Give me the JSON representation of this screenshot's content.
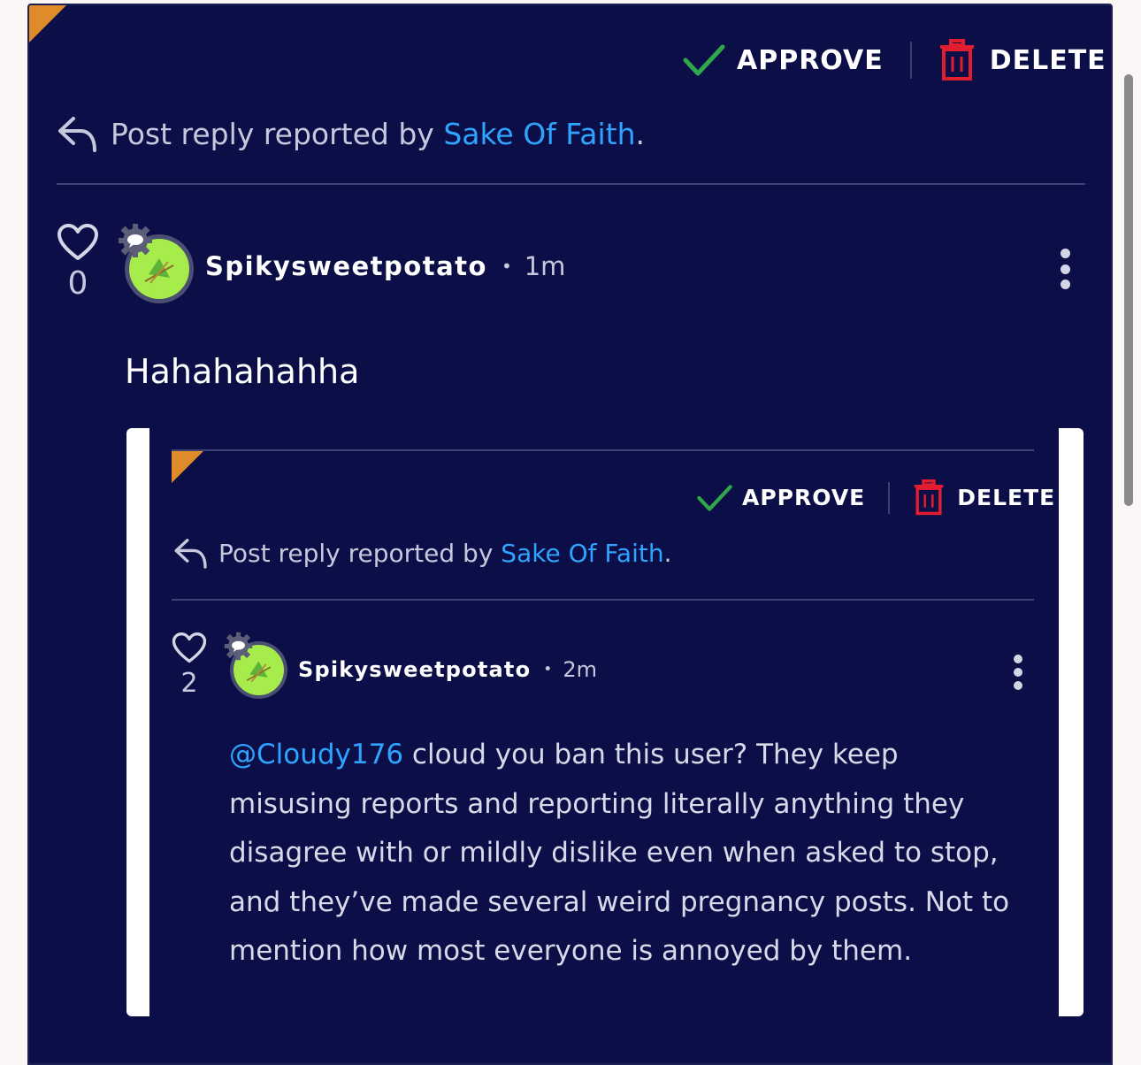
{
  "outer": {
    "actions": {
      "approve_label": "APPROVE",
      "delete_label": "DELETE"
    },
    "report": {
      "prefix": "Post reply reported by ",
      "reporter": "Sake Of Faith",
      "suffix": "."
    },
    "post": {
      "likes": "0",
      "username": "Spikysweetpotato",
      "separator": "•",
      "time": "1m",
      "body": "Hahahahahha"
    }
  },
  "embedded": {
    "actions": {
      "approve_label": "APPROVE",
      "delete_label": "DELETE"
    },
    "report": {
      "prefix": "Post reply reported by ",
      "reporter": "Sake Of Faith",
      "suffix": "."
    },
    "post": {
      "likes": "2",
      "username": "Spikysweetpotato",
      "separator": "•",
      "time": "2m",
      "mention": "@Cloudy176",
      "body": " cloud you ban this user? They keep misusing reports and reporting literally anything they disagree with or mildly dislike even when asked to stop, and they’ve made several weird pregnancy posts. Not to mention how most everyone is annoyed by them."
    }
  },
  "colors": {
    "background": "#0c0f47",
    "link": "#2fa4ff",
    "approve": "#2fa84a",
    "delete": "#e11d2f",
    "flag": "#e08b2a",
    "avatar": "#a6ec4a"
  },
  "icons": [
    "check-icon",
    "trash-icon",
    "reply-icon",
    "heart-icon",
    "gear-icon",
    "kebab-icon",
    "flag-corner-icon"
  ]
}
